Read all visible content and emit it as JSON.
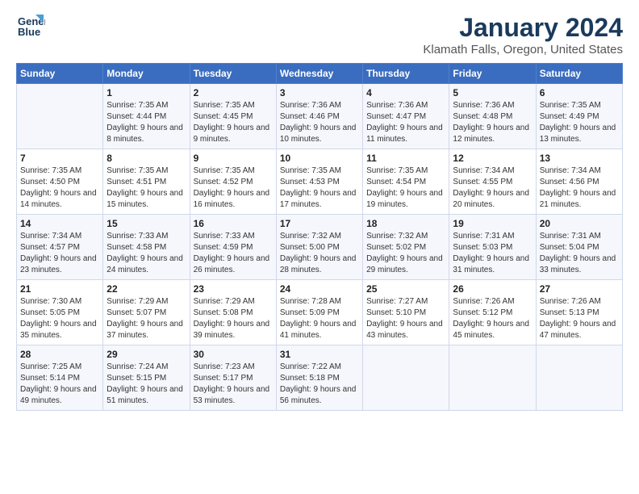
{
  "logo": {
    "line1": "General",
    "line2": "Blue"
  },
  "title": "January 2024",
  "subtitle": "Klamath Falls, Oregon, United States",
  "days_of_week": [
    "Sunday",
    "Monday",
    "Tuesday",
    "Wednesday",
    "Thursday",
    "Friday",
    "Saturday"
  ],
  "weeks": [
    [
      {
        "day": "",
        "sunrise": "",
        "sunset": "",
        "daylight": ""
      },
      {
        "day": "1",
        "sunrise": "Sunrise: 7:35 AM",
        "sunset": "Sunset: 4:44 PM",
        "daylight": "Daylight: 9 hours and 8 minutes."
      },
      {
        "day": "2",
        "sunrise": "Sunrise: 7:35 AM",
        "sunset": "Sunset: 4:45 PM",
        "daylight": "Daylight: 9 hours and 9 minutes."
      },
      {
        "day": "3",
        "sunrise": "Sunrise: 7:36 AM",
        "sunset": "Sunset: 4:46 PM",
        "daylight": "Daylight: 9 hours and 10 minutes."
      },
      {
        "day": "4",
        "sunrise": "Sunrise: 7:36 AM",
        "sunset": "Sunset: 4:47 PM",
        "daylight": "Daylight: 9 hours and 11 minutes."
      },
      {
        "day": "5",
        "sunrise": "Sunrise: 7:36 AM",
        "sunset": "Sunset: 4:48 PM",
        "daylight": "Daylight: 9 hours and 12 minutes."
      },
      {
        "day": "6",
        "sunrise": "Sunrise: 7:35 AM",
        "sunset": "Sunset: 4:49 PM",
        "daylight": "Daylight: 9 hours and 13 minutes."
      }
    ],
    [
      {
        "day": "7",
        "sunrise": "Sunrise: 7:35 AM",
        "sunset": "Sunset: 4:50 PM",
        "daylight": "Daylight: 9 hours and 14 minutes."
      },
      {
        "day": "8",
        "sunrise": "Sunrise: 7:35 AM",
        "sunset": "Sunset: 4:51 PM",
        "daylight": "Daylight: 9 hours and 15 minutes."
      },
      {
        "day": "9",
        "sunrise": "Sunrise: 7:35 AM",
        "sunset": "Sunset: 4:52 PM",
        "daylight": "Daylight: 9 hours and 16 minutes."
      },
      {
        "day": "10",
        "sunrise": "Sunrise: 7:35 AM",
        "sunset": "Sunset: 4:53 PM",
        "daylight": "Daylight: 9 hours and 17 minutes."
      },
      {
        "day": "11",
        "sunrise": "Sunrise: 7:35 AM",
        "sunset": "Sunset: 4:54 PM",
        "daylight": "Daylight: 9 hours and 19 minutes."
      },
      {
        "day": "12",
        "sunrise": "Sunrise: 7:34 AM",
        "sunset": "Sunset: 4:55 PM",
        "daylight": "Daylight: 9 hours and 20 minutes."
      },
      {
        "day": "13",
        "sunrise": "Sunrise: 7:34 AM",
        "sunset": "Sunset: 4:56 PM",
        "daylight": "Daylight: 9 hours and 21 minutes."
      }
    ],
    [
      {
        "day": "14",
        "sunrise": "Sunrise: 7:34 AM",
        "sunset": "Sunset: 4:57 PM",
        "daylight": "Daylight: 9 hours and 23 minutes."
      },
      {
        "day": "15",
        "sunrise": "Sunrise: 7:33 AM",
        "sunset": "Sunset: 4:58 PM",
        "daylight": "Daylight: 9 hours and 24 minutes."
      },
      {
        "day": "16",
        "sunrise": "Sunrise: 7:33 AM",
        "sunset": "Sunset: 4:59 PM",
        "daylight": "Daylight: 9 hours and 26 minutes."
      },
      {
        "day": "17",
        "sunrise": "Sunrise: 7:32 AM",
        "sunset": "Sunset: 5:00 PM",
        "daylight": "Daylight: 9 hours and 28 minutes."
      },
      {
        "day": "18",
        "sunrise": "Sunrise: 7:32 AM",
        "sunset": "Sunset: 5:02 PM",
        "daylight": "Daylight: 9 hours and 29 minutes."
      },
      {
        "day": "19",
        "sunrise": "Sunrise: 7:31 AM",
        "sunset": "Sunset: 5:03 PM",
        "daylight": "Daylight: 9 hours and 31 minutes."
      },
      {
        "day": "20",
        "sunrise": "Sunrise: 7:31 AM",
        "sunset": "Sunset: 5:04 PM",
        "daylight": "Daylight: 9 hours and 33 minutes."
      }
    ],
    [
      {
        "day": "21",
        "sunrise": "Sunrise: 7:30 AM",
        "sunset": "Sunset: 5:05 PM",
        "daylight": "Daylight: 9 hours and 35 minutes."
      },
      {
        "day": "22",
        "sunrise": "Sunrise: 7:29 AM",
        "sunset": "Sunset: 5:07 PM",
        "daylight": "Daylight: 9 hours and 37 minutes."
      },
      {
        "day": "23",
        "sunrise": "Sunrise: 7:29 AM",
        "sunset": "Sunset: 5:08 PM",
        "daylight": "Daylight: 9 hours and 39 minutes."
      },
      {
        "day": "24",
        "sunrise": "Sunrise: 7:28 AM",
        "sunset": "Sunset: 5:09 PM",
        "daylight": "Daylight: 9 hours and 41 minutes."
      },
      {
        "day": "25",
        "sunrise": "Sunrise: 7:27 AM",
        "sunset": "Sunset: 5:10 PM",
        "daylight": "Daylight: 9 hours and 43 minutes."
      },
      {
        "day": "26",
        "sunrise": "Sunrise: 7:26 AM",
        "sunset": "Sunset: 5:12 PM",
        "daylight": "Daylight: 9 hours and 45 minutes."
      },
      {
        "day": "27",
        "sunrise": "Sunrise: 7:26 AM",
        "sunset": "Sunset: 5:13 PM",
        "daylight": "Daylight: 9 hours and 47 minutes."
      }
    ],
    [
      {
        "day": "28",
        "sunrise": "Sunrise: 7:25 AM",
        "sunset": "Sunset: 5:14 PM",
        "daylight": "Daylight: 9 hours and 49 minutes."
      },
      {
        "day": "29",
        "sunrise": "Sunrise: 7:24 AM",
        "sunset": "Sunset: 5:15 PM",
        "daylight": "Daylight: 9 hours and 51 minutes."
      },
      {
        "day": "30",
        "sunrise": "Sunrise: 7:23 AM",
        "sunset": "Sunset: 5:17 PM",
        "daylight": "Daylight: 9 hours and 53 minutes."
      },
      {
        "day": "31",
        "sunrise": "Sunrise: 7:22 AM",
        "sunset": "Sunset: 5:18 PM",
        "daylight": "Daylight: 9 hours and 56 minutes."
      },
      {
        "day": "",
        "sunrise": "",
        "sunset": "",
        "daylight": ""
      },
      {
        "day": "",
        "sunrise": "",
        "sunset": "",
        "daylight": ""
      },
      {
        "day": "",
        "sunrise": "",
        "sunset": "",
        "daylight": ""
      }
    ]
  ]
}
